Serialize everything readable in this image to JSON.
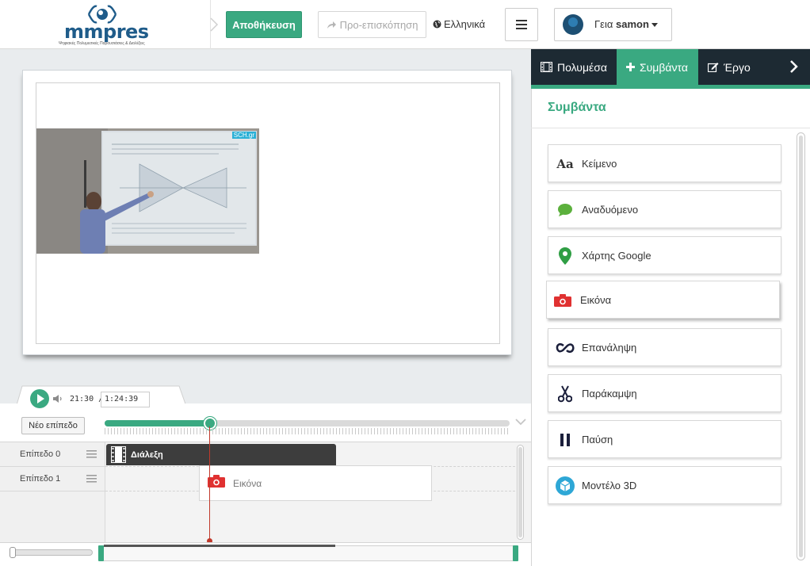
{
  "header": {
    "logo_text": "mmpres",
    "logo_subtitle": "Ψηφιακές Πολυμεσικές Παρουσιάσεις & Διαλέξεις",
    "save_label": "Αποθήκευση",
    "preview_label": "Προ-επισκόπηση",
    "language_label": "Ελληνικά",
    "greeting": "Γεια",
    "username": "samon"
  },
  "stage": {
    "video_tag": "SCH.gr"
  },
  "timeline": {
    "current_time": "21:30 /",
    "total_time": "1:24:39",
    "new_layer_label": "Νέο επίπεδο",
    "progress_percent": 26,
    "layers": [
      {
        "label": "Επίπεδο 0"
      },
      {
        "label": "Επίπεδο 1"
      }
    ],
    "events": {
      "lecture": "Διάλεξη",
      "image": "Εικόνα"
    }
  },
  "panel": {
    "tabs": [
      {
        "label": "Πολυμέσα"
      },
      {
        "label": "Συμβάντα"
      },
      {
        "label": "Έργο"
      }
    ],
    "title": "Συμβάντα",
    "items": [
      {
        "label": "Κείμενο",
        "icon": "text-icon"
      },
      {
        "label": "Αναδυόμενο",
        "icon": "speech-bubble-icon"
      },
      {
        "label": "Χάρτης Google",
        "icon": "map-pin-icon"
      },
      {
        "label": "Εικόνα",
        "icon": "camera-icon"
      },
      {
        "label": "Επανάληψη",
        "icon": "loop-icon"
      },
      {
        "label": "Παράκαμψη",
        "icon": "scissors-icon"
      },
      {
        "label": "Παύση",
        "icon": "pause-icon"
      },
      {
        "label": "Μοντέλο 3D",
        "icon": "cube-icon"
      }
    ]
  },
  "colors": {
    "accent": "#3aa981",
    "tabbar": "#1d2a33",
    "brand_blue": "#1f5c8a",
    "camera_red": "#e03131"
  }
}
